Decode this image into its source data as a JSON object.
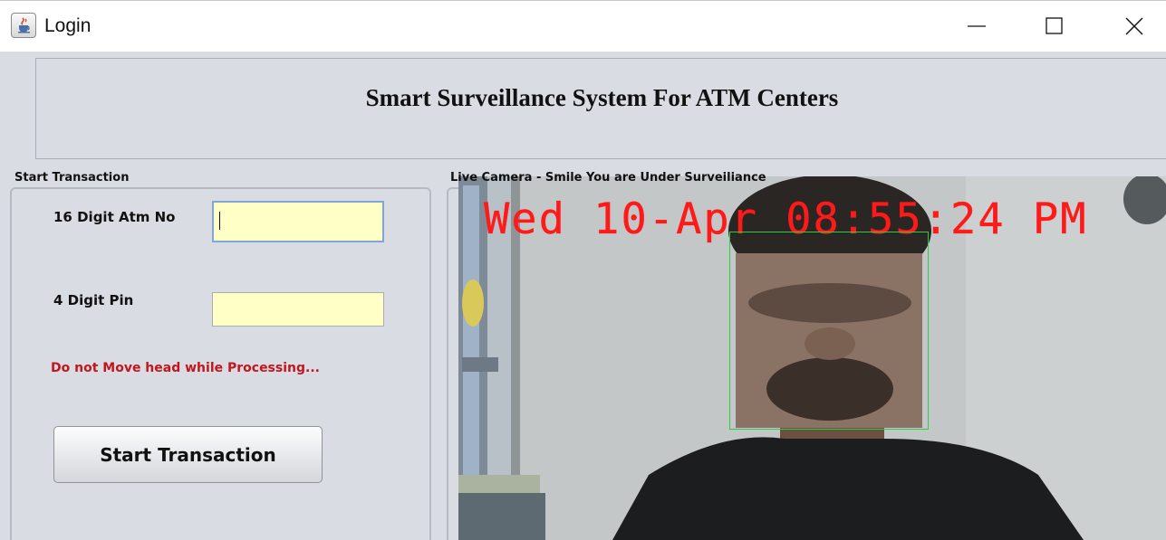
{
  "window": {
    "title": "Login",
    "icon": "java-cup-icon",
    "controls": [
      "minimize-icon",
      "maximize-icon",
      "close-icon"
    ]
  },
  "header": {
    "title": "Smart Surveillance System For ATM Centers"
  },
  "transaction": {
    "group_label": "Start Transaction",
    "atm_label": "16 Digit Atm No",
    "atm_value": "",
    "pin_label": "4 Digit Pin",
    "pin_value": "",
    "warning": "Do not Move head while Processing...",
    "button_label": "Start Transaction"
  },
  "camera": {
    "group_label": "Live Camera - Smile You are Under Surveiliance",
    "timestamp": "Wed 10-Apr 08:55:24 PM"
  },
  "colors": {
    "input_bg": "#ffffc6",
    "warning": "#c4161c",
    "timestamp": "#ff1a1a",
    "face_box": "#2ecc40",
    "window_bg": "#d9dce3"
  }
}
